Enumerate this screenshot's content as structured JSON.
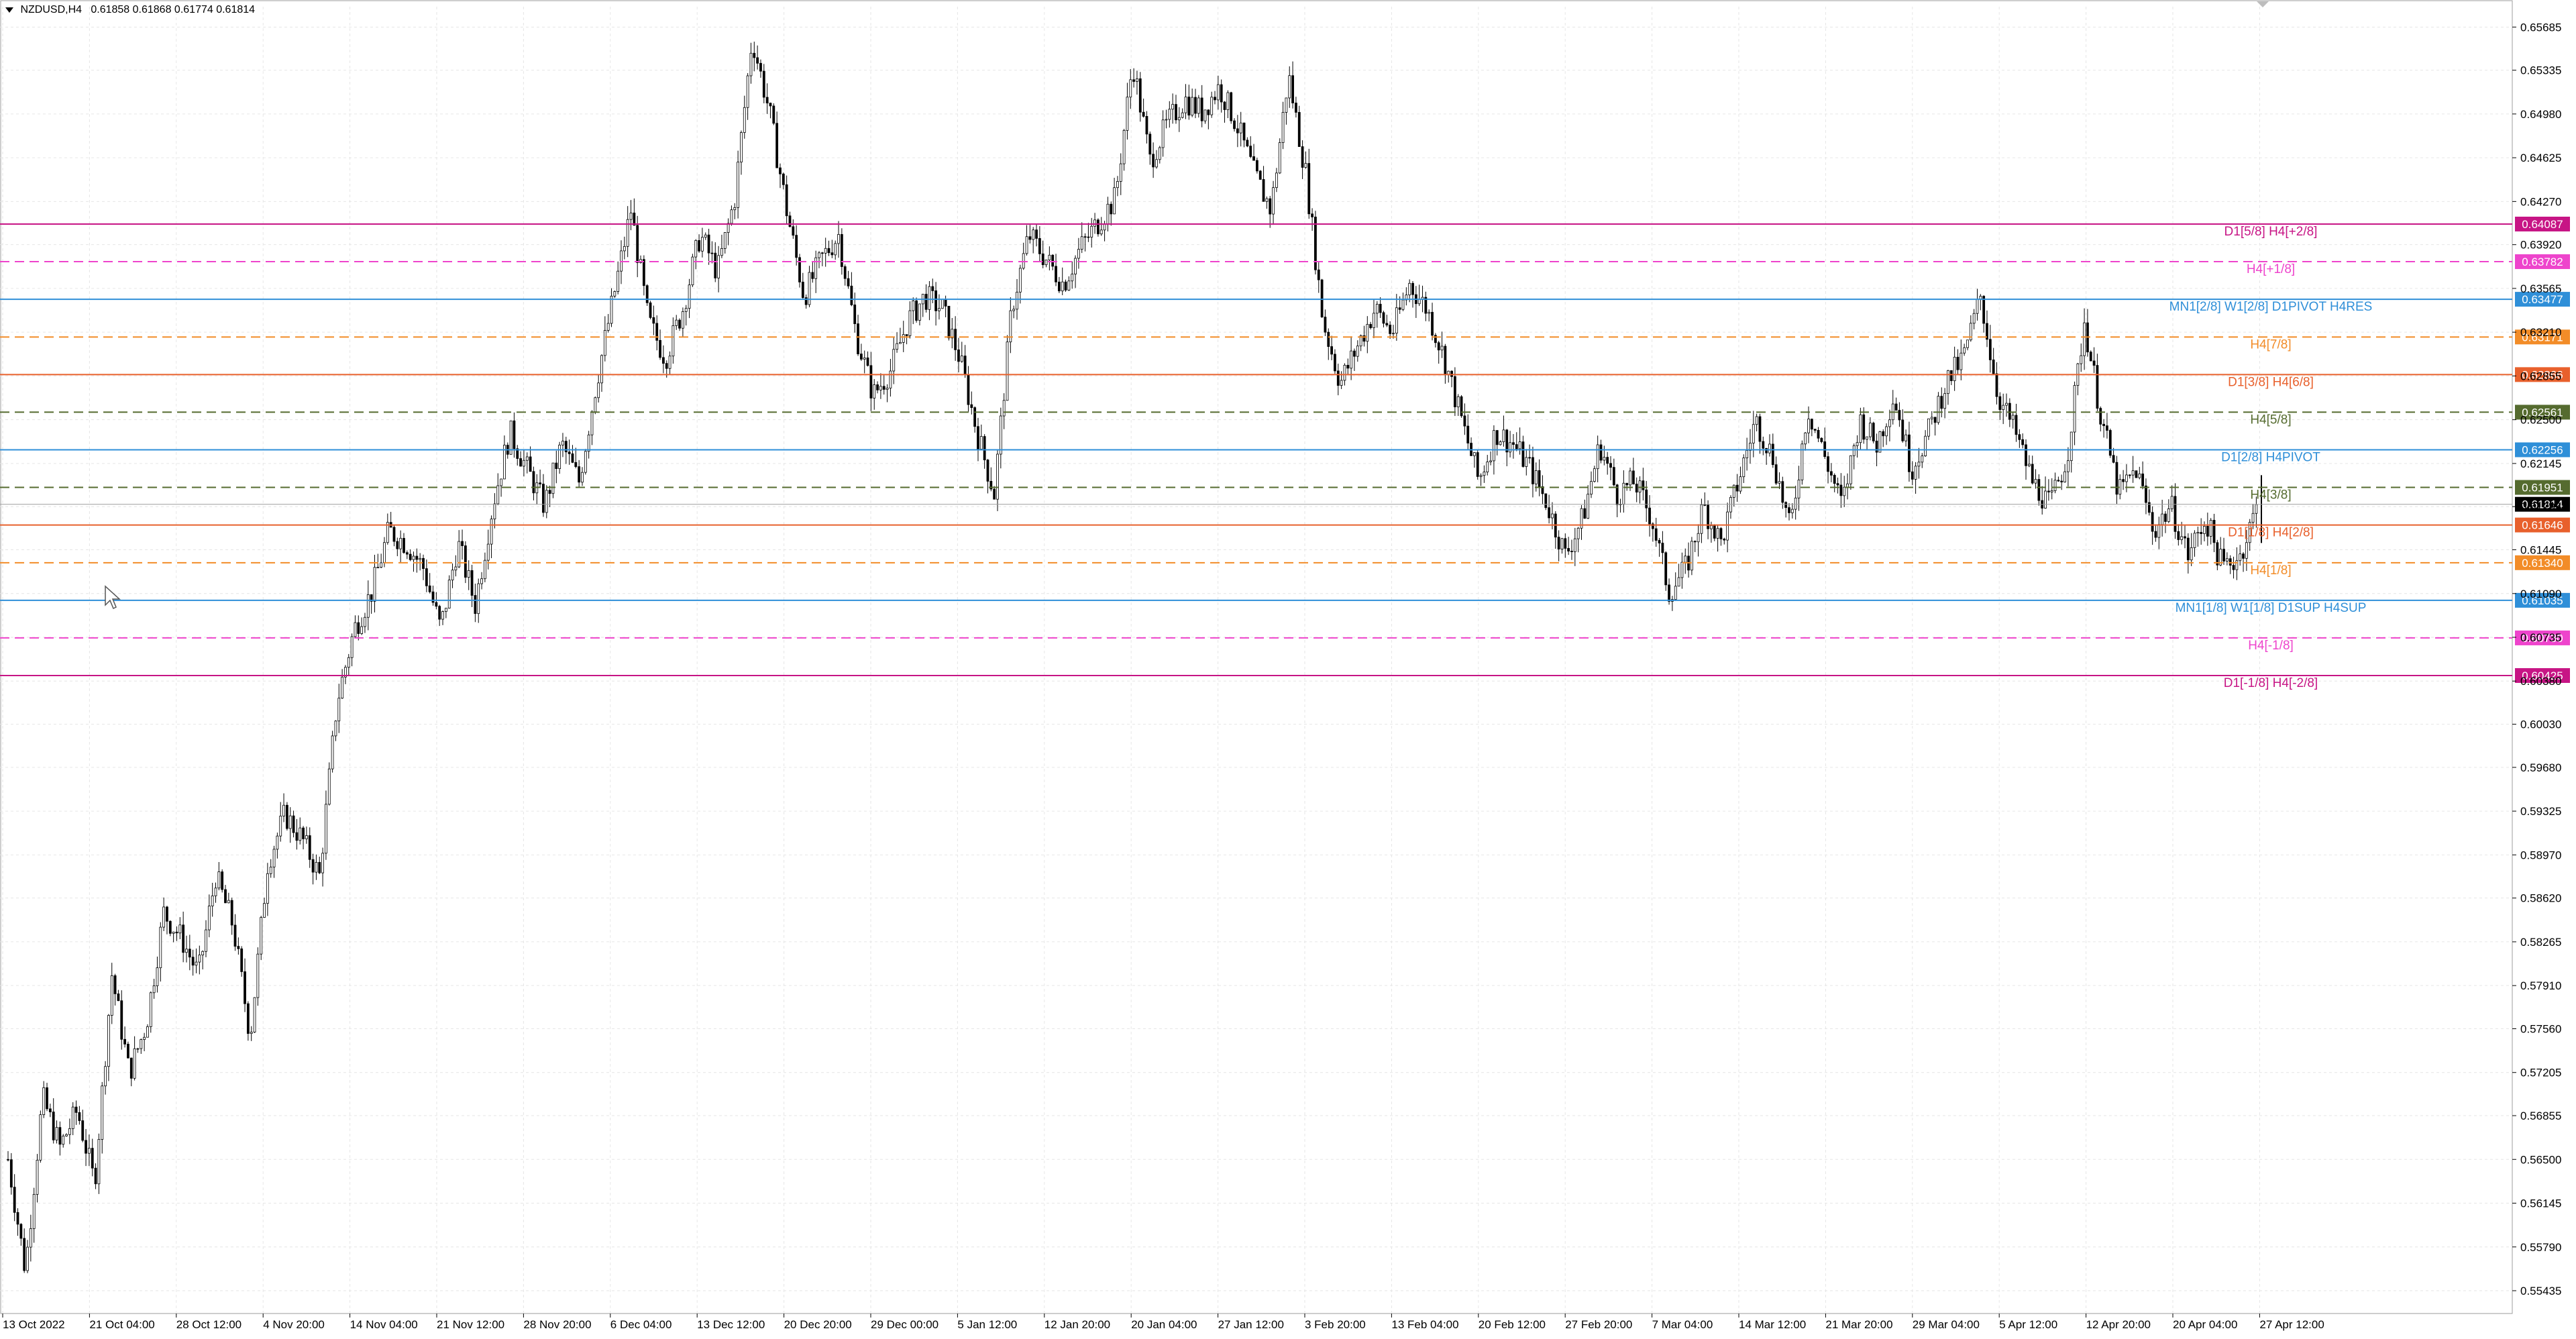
{
  "window": {
    "symbol": "NZDUSD,H4",
    "ohlc": "0.61858 0.61868 0.61774 0.61814"
  },
  "colors": {
    "background": "#ffffff",
    "grid": "#e6e6e6",
    "candle": "#000000",
    "axis_text": "#000000"
  },
  "chart_data": {
    "type": "candlestick",
    "symbol": "NZDUSD",
    "timeframe": "H4",
    "last_price": 0.61814,
    "ylim": [
      0.5525,
      0.6585
    ],
    "y_ticks": [
      "0.65685",
      "0.65335",
      "0.64980",
      "0.64625",
      "0.64270",
      "0.63920",
      "0.63565",
      "0.63210",
      "0.62855",
      "0.62500",
      "0.62145",
      "0.61795",
      "0.61445",
      "0.61090",
      "0.60735",
      "0.60380",
      "0.60030",
      "0.59680",
      "0.59325",
      "0.58970",
      "0.58620",
      "0.58265",
      "0.57910",
      "0.57560",
      "0.57205",
      "0.56855",
      "0.56500",
      "0.56145",
      "0.55790",
      "0.55435"
    ],
    "x_ticks": [
      "13 Oct 2022",
      "21 Oct 04:00",
      "28 Oct 12:00",
      "4 Nov 20:00",
      "14 Nov 04:00",
      "21 Nov 12:00",
      "28 Nov 20:00",
      "6 Dec 04:00",
      "13 Dec 12:00",
      "20 Dec 20:00",
      "29 Dec 00:00",
      "5 Jan 12:00",
      "12 Jan 20:00",
      "20 Jan 04:00",
      "27 Jan 12:00",
      "3 Feb 20:00",
      "13 Feb 04:00",
      "20 Feb 12:00",
      "27 Feb 20:00",
      "7 Mar 04:00",
      "14 Mar 12:00",
      "21 Mar 20:00",
      "29 Mar 04:00",
      "5 Apr 12:00",
      "12 Apr 20:00",
      "20 Apr 04:00",
      "27 Apr 12:00"
    ],
    "price_path": [
      [
        0,
        0.565
      ],
      [
        4,
        0.556
      ],
      [
        8,
        0.57
      ],
      [
        12,
        0.566
      ],
      [
        16,
        0.569
      ],
      [
        20,
        0.563
      ],
      [
        24,
        0.58
      ],
      [
        28,
        0.572
      ],
      [
        32,
        0.576
      ],
      [
        36,
        0.585
      ],
      [
        40,
        0.583
      ],
      [
        44,
        0.58
      ],
      [
        48,
        0.588
      ],
      [
        52,
        0.584
      ],
      [
        56,
        0.575
      ],
      [
        60,
        0.589
      ],
      [
        64,
        0.593
      ],
      [
        68,
        0.591
      ],
      [
        72,
        0.588
      ],
      [
        76,
        0.602
      ],
      [
        80,
        0.608
      ],
      [
        84,
        0.611
      ],
      [
        88,
        0.616
      ],
      [
        92,
        0.615
      ],
      [
        96,
        0.613
      ],
      [
        100,
        0.608
      ],
      [
        104,
        0.615
      ],
      [
        108,
        0.61
      ],
      [
        112,
        0.618
      ],
      [
        116,
        0.624
      ],
      [
        120,
        0.621
      ],
      [
        124,
        0.618
      ],
      [
        128,
        0.623
      ],
      [
        132,
        0.62
      ],
      [
        136,
        0.628
      ],
      [
        140,
        0.635
      ],
      [
        144,
        0.642
      ],
      [
        148,
        0.633
      ],
      [
        152,
        0.63
      ],
      [
        156,
        0.634
      ],
      [
        160,
        0.64
      ],
      [
        164,
        0.637
      ],
      [
        168,
        0.643
      ],
      [
        172,
        0.656
      ],
      [
        176,
        0.65
      ],
      [
        180,
        0.642
      ],
      [
        184,
        0.635
      ],
      [
        188,
        0.638
      ],
      [
        192,
        0.64
      ],
      [
        196,
        0.632
      ],
      [
        200,
        0.627
      ],
      [
        204,
        0.629
      ],
      [
        208,
        0.633
      ],
      [
        212,
        0.635
      ],
      [
        216,
        0.634
      ],
      [
        220,
        0.63
      ],
      [
        224,
        0.624
      ],
      [
        228,
        0.619
      ],
      [
        232,
        0.634
      ],
      [
        236,
        0.64
      ],
      [
        240,
        0.638
      ],
      [
        244,
        0.636
      ],
      [
        248,
        0.639
      ],
      [
        252,
        0.641
      ],
      [
        256,
        0.643
      ],
      [
        260,
        0.654
      ],
      [
        264,
        0.646
      ],
      [
        268,
        0.649
      ],
      [
        272,
        0.651
      ],
      [
        276,
        0.65
      ],
      [
        280,
        0.652
      ],
      [
        284,
        0.649
      ],
      [
        288,
        0.645
      ],
      [
        292,
        0.642
      ],
      [
        296,
        0.653
      ],
      [
        300,
        0.645
      ],
      [
        304,
        0.633
      ],
      [
        308,
        0.628
      ],
      [
        312,
        0.631
      ],
      [
        316,
        0.634
      ],
      [
        320,
        0.632
      ],
      [
        324,
        0.636
      ],
      [
        328,
        0.634
      ],
      [
        332,
        0.63
      ],
      [
        336,
        0.625
      ],
      [
        340,
        0.62
      ],
      [
        344,
        0.624
      ],
      [
        348,
        0.623
      ],
      [
        352,
        0.621
      ],
      [
        356,
        0.618
      ],
      [
        360,
        0.614
      ],
      [
        364,
        0.617
      ],
      [
        368,
        0.623
      ],
      [
        372,
        0.619
      ],
      [
        376,
        0.62
      ],
      [
        380,
        0.617
      ],
      [
        384,
        0.611
      ],
      [
        388,
        0.613
      ],
      [
        392,
        0.618
      ],
      [
        396,
        0.615
      ],
      [
        400,
        0.62
      ],
      [
        404,
        0.625
      ],
      [
        408,
        0.622
      ],
      [
        412,
        0.616
      ],
      [
        416,
        0.626
      ],
      [
        420,
        0.622
      ],
      [
        424,
        0.618
      ],
      [
        428,
        0.625
      ],
      [
        432,
        0.623
      ],
      [
        436,
        0.627
      ],
      [
        440,
        0.621
      ],
      [
        444,
        0.624
      ],
      [
        448,
        0.628
      ],
      [
        452,
        0.63
      ],
      [
        456,
        0.635
      ],
      [
        460,
        0.627
      ],
      [
        464,
        0.624
      ],
      [
        468,
        0.62
      ],
      [
        472,
        0.618
      ],
      [
        476,
        0.622
      ],
      [
        480,
        0.633
      ],
      [
        484,
        0.625
      ],
      [
        488,
        0.619
      ],
      [
        492,
        0.621
      ],
      [
        496,
        0.616
      ],
      [
        500,
        0.618
      ],
      [
        504,
        0.614
      ],
      [
        508,
        0.617
      ],
      [
        512,
        0.613
      ],
      [
        516,
        0.614
      ],
      [
        520,
        0.618
      ]
    ],
    "price_path_x_range": [
      0,
      520
    ],
    "levels": [
      {
        "price": 0.64087,
        "label": "D1[5/8] H4[+2/8]",
        "tag": "0.64087",
        "color": "#c71585",
        "style": "solid"
      },
      {
        "price": 0.63782,
        "label": "H4[+1/8]",
        "tag": "0.63782",
        "color": "#ee44cc",
        "style": "dashed"
      },
      {
        "price": 0.63477,
        "label": "MN1[2/8] W1[2/8] D1PIVOT H4RES",
        "tag": "0.63477",
        "color": "#2f8fd8",
        "style": "solid"
      },
      {
        "price": 0.63171,
        "label": "H4[7/8]",
        "tag": "0.63171",
        "color": "#f28c28",
        "style": "dashed"
      },
      {
        "price": 0.62866,
        "label": "D1[3/8] H4[6/8]",
        "tag": "0.62866",
        "color": "#e8602c",
        "style": "solid"
      },
      {
        "price": 0.62561,
        "label": "H4[5/8]",
        "tag": "0.62561",
        "color": "#556b2f",
        "style": "dashed"
      },
      {
        "price": 0.62256,
        "label": "D1[2/8] H4PIVOT",
        "tag": "0.62256",
        "color": "#2f8fd8",
        "style": "solid"
      },
      {
        "price": 0.61951,
        "label": "H4[3/8]",
        "tag": "0.61951",
        "color": "#556b2f",
        "style": "dashed"
      },
      {
        "price": 0.61646,
        "label": "D1[1/8] H4[2/8]",
        "tag": "0.61646",
        "color": "#e8602c",
        "style": "solid"
      },
      {
        "price": 0.6134,
        "label": "H4[1/8]",
        "tag": "0.61340",
        "color": "#f28c28",
        "style": "dashed"
      },
      {
        "price": 0.61035,
        "label": "MN1[1/8] W1[1/8] D1SUP H4SUP",
        "tag": "0.61035",
        "color": "#2f8fd8",
        "style": "solid"
      },
      {
        "price": 0.6073,
        "label": "H4[-1/8]",
        "tag": "0.60730",
        "color": "#ee44cc",
        "style": "dashed"
      },
      {
        "price": 0.60425,
        "label": "D1[-1/8] H4[-2/8]",
        "tag": "0.60425",
        "color": "#c71585",
        "style": "solid"
      }
    ],
    "bid_tag": {
      "price": 0.61814,
      "tag": "0.61814",
      "color": "#000000"
    },
    "grid": true
  }
}
